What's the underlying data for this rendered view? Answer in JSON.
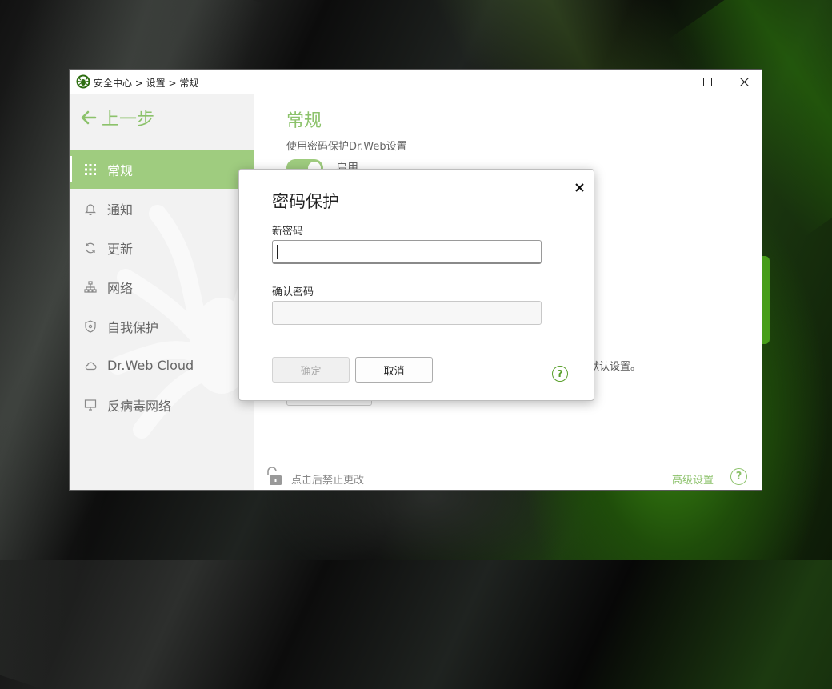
{
  "window": {
    "breadcrumb": "安全中心 > 设置 > 常规"
  },
  "sidebar": {
    "back_label": "上一步",
    "items": [
      {
        "label": "常规",
        "icon": "grid-icon",
        "active": true
      },
      {
        "label": "通知",
        "icon": "bell-icon"
      },
      {
        "label": "更新",
        "icon": "refresh-icon"
      },
      {
        "label": "网络",
        "icon": "network-icon"
      },
      {
        "label": "自我保护",
        "icon": "shield-icon"
      },
      {
        "label": "Dr.Web Cloud",
        "icon": "cloud-icon"
      },
      {
        "label": "反病毒网络",
        "icon": "monitor-icon"
      }
    ]
  },
  "main": {
    "title": "常规",
    "subtitle": "使用密码保护Dr.Web设置",
    "toggle_label": "启用",
    "reset_text": "默认设置。",
    "lock_text": "点击后禁止更改",
    "advanced_link": "高级设置"
  },
  "dialog": {
    "title": "密码保护",
    "new_password_label": "新密码",
    "new_password_value": "",
    "confirm_password_label": "确认密码",
    "confirm_password_value": "",
    "ok_label": "确定",
    "cancel_label": "取消",
    "help_glyph": "?"
  },
  "colors": {
    "accent": "#8cc26b",
    "active_nav": "#9fcc7f"
  }
}
